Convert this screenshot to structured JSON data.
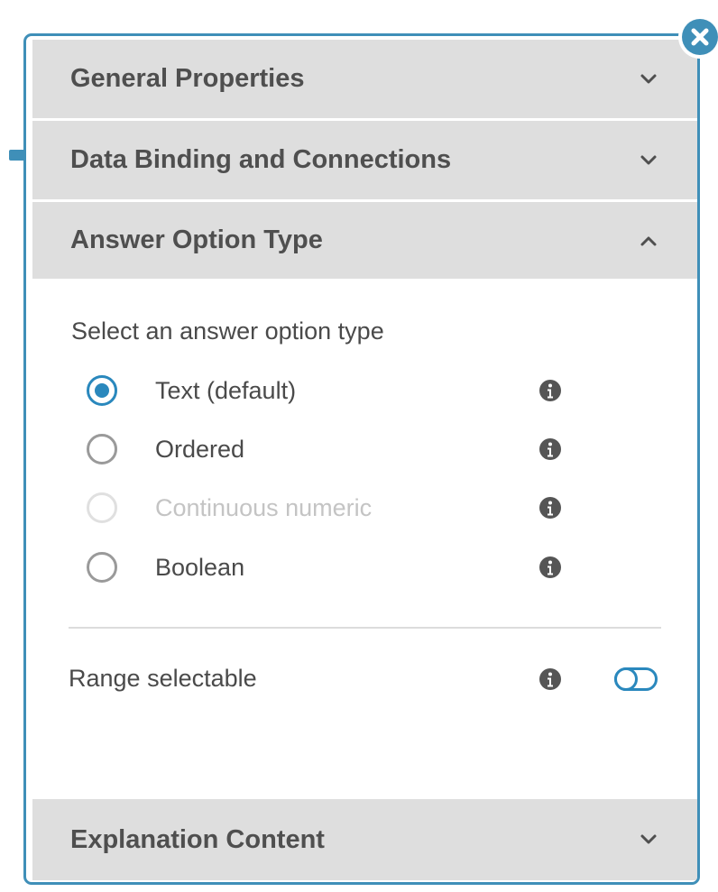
{
  "colors": {
    "accent": "#2a88bd",
    "border": "#3f8fb8",
    "header_bg": "#dedede",
    "disabled": "#c4c4c4"
  },
  "close_icon": "close-icon",
  "sections": {
    "general": {
      "title": "General Properties",
      "icon": "chevron-down-icon",
      "expanded": false
    },
    "data_binding": {
      "title": "Data Binding and Connections",
      "icon": "chevron-down-icon",
      "expanded": false
    },
    "answer_option_type": {
      "title": "Answer Option Type",
      "icon": "chevron-up-icon",
      "expanded": true
    },
    "explanation": {
      "title": "Explanation Content",
      "icon": "chevron-down-icon",
      "expanded": false
    }
  },
  "answer_option": {
    "prompt": "Select an answer option type",
    "options": [
      {
        "label": "Text (default)",
        "selected": true,
        "disabled": false,
        "icon": "info-icon"
      },
      {
        "label": "Ordered",
        "selected": false,
        "disabled": false,
        "icon": "info-icon"
      },
      {
        "label": "Continuous numeric",
        "selected": false,
        "disabled": true,
        "icon": "info-icon"
      },
      {
        "label": "Boolean",
        "selected": false,
        "disabled": false,
        "icon": "info-icon"
      }
    ],
    "range_selectable": {
      "label": "Range selectable",
      "enabled": false,
      "icon": "info-icon"
    }
  }
}
